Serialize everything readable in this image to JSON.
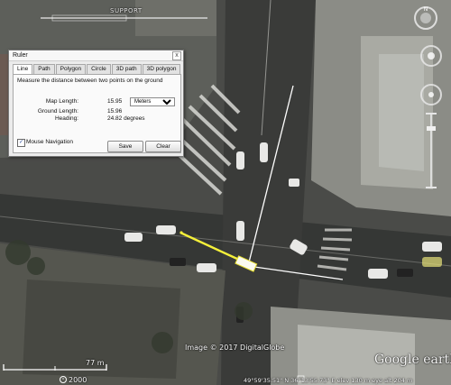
{
  "map": {
    "scale_top_label": "SUPPORT",
    "imagery_credit": "Image © 2017 DigitalGlobe",
    "scale_bar_label": "77 m",
    "timeline_year": "2000",
    "logo": "Google earth",
    "status_bar": "49°59'35.51\" N   36°13'55.73\" E  elev  130 m    eye alt  204 m"
  },
  "ruler": {
    "window_title": "Ruler",
    "close_glyph": "x",
    "tabs": [
      "Line",
      "Path",
      "Polygon",
      "Circle",
      "3D path",
      "3D polygon"
    ],
    "active_tab": "Line",
    "description": "Measure the distance between two points on the ground",
    "map_length_label": "Map Length:",
    "map_length_value": "15.95",
    "unit_selected": "Meters",
    "ground_length_label": "Ground Length:",
    "ground_length_value": "15.96",
    "heading_label": "Heading:",
    "heading_value": "24.82 degrees",
    "mouse_nav_label": "Mouse Navigation",
    "mouse_nav_checked": true,
    "save_label": "Save",
    "clear_label": "Clear"
  },
  "colors": {
    "measure_line": "#f5f03a",
    "overlay_line": "#ffffff"
  }
}
